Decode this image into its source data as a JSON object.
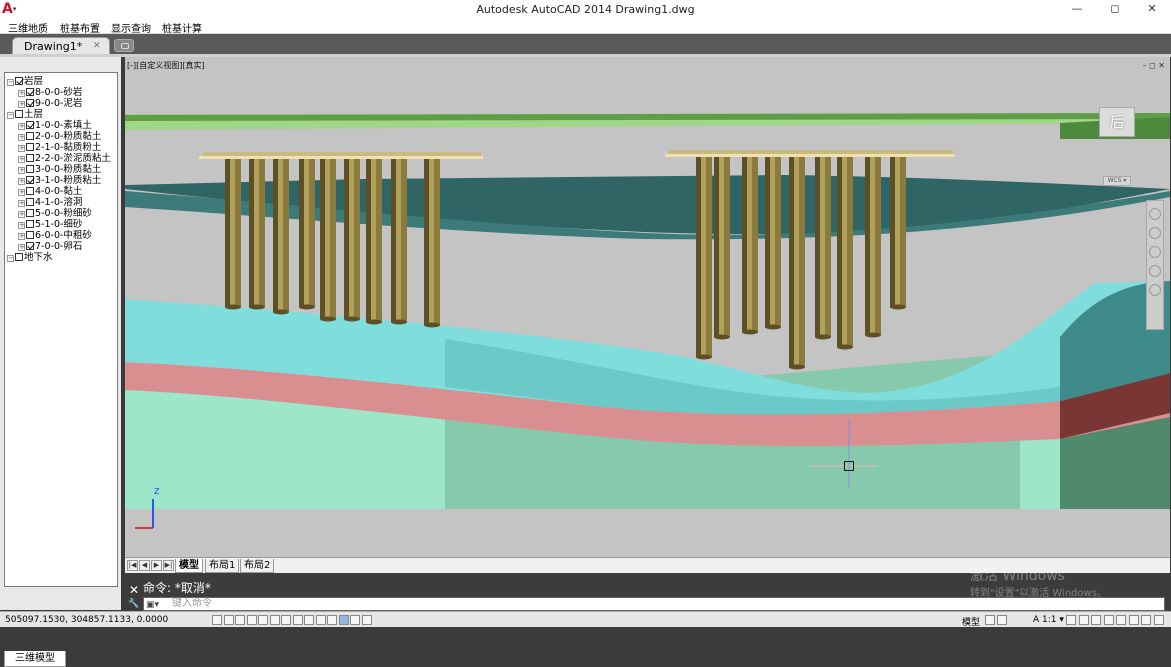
{
  "window": {
    "title": "Autodesk AutoCAD 2014    Drawing1.dwg",
    "minimize_icon": "minimize-icon",
    "maximize_icon": "maximize-icon",
    "close_icon": "close-icon"
  },
  "app_logo": {
    "label": "A",
    "caret": "▾"
  },
  "menu": [
    "三维地质",
    "桩基布置",
    "显示查询",
    "桩基计算"
  ],
  "document_tab": {
    "label": "Drawing1*",
    "close": "✕"
  },
  "tree": [
    {
      "label": "岩层",
      "level": 0,
      "checked": true
    },
    {
      "label": "8-0-0-砂岩",
      "level": 1,
      "checked": true
    },
    {
      "label": "9-0-0-泥岩",
      "level": 1,
      "checked": true
    },
    {
      "label": "土层",
      "level": 0,
      "checked": false
    },
    {
      "label": "1-0-0-素填土",
      "level": 1,
      "checked": true
    },
    {
      "label": "2-0-0-粉质黏土",
      "level": 1,
      "checked": false
    },
    {
      "label": "2-1-0-黏质粉土",
      "level": 1,
      "checked": false
    },
    {
      "label": "2-2-0-淤泥质粘土",
      "level": 1,
      "checked": false
    },
    {
      "label": "3-0-0-粉质黏土",
      "level": 1,
      "checked": false
    },
    {
      "label": "3-1-0-粉质粘土",
      "level": 1,
      "checked": true
    },
    {
      "label": "4-0-0-黏土",
      "level": 1,
      "checked": false
    },
    {
      "label": "4-1-0-溶洞",
      "level": 1,
      "checked": false
    },
    {
      "label": "5-0-0-粉细砂",
      "level": 1,
      "checked": false
    },
    {
      "label": "5-1-0-细砂",
      "level": 1,
      "checked": false
    },
    {
      "label": "6-0-0-中粗砂",
      "level": 1,
      "checked": false
    },
    {
      "label": "7-0-0-卵石",
      "level": 1,
      "checked": true
    },
    {
      "label": "地下水",
      "level": 0,
      "checked": false
    }
  ],
  "panel_tab": "三维模型",
  "viewport": {
    "label": "[-][自定义视图][真实]",
    "controls": "– ◻ ✕",
    "viewcube": "后",
    "wcs": "WCS ▾",
    "ucs_z": "Z"
  },
  "layout_tabs": [
    "模型",
    "布局1",
    "布局2"
  ],
  "command": {
    "history": "命令: *取消*",
    "placeholder": "键入命令"
  },
  "watermark": {
    "line1": "激活 Windows",
    "line2": "转到\"设置\"以激活 Windows。"
  },
  "status": {
    "coords": "505097.1530,  304857.1133,  0.0000",
    "model": "模型",
    "scale": "A 1:1 ▾"
  },
  "colors": {
    "pile": "#8b7a3e",
    "pile_cap": "#c9b982",
    "rock_layer": "#2f6565",
    "fill_layer": "#7fdedc",
    "clay_layer": "#d98f90",
    "gravel_layer": "#9de6c9",
    "top_layer": "#9fd68a"
  }
}
